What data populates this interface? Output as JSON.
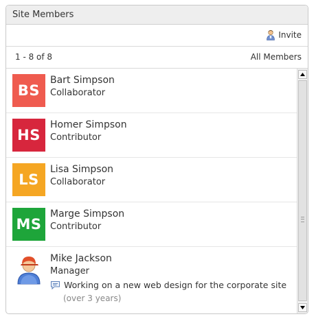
{
  "dashlet": {
    "title": "Site Members",
    "invite_label": "Invite",
    "count_text": "1 - 8 of 8",
    "all_members_label": "All Members"
  },
  "members": [
    {
      "initials": "BS",
      "name": "Bart Simpson",
      "role": "Collaborator",
      "color": "#ef5b4f"
    },
    {
      "initials": "HS",
      "name": "Homer Simpson",
      "role": "Contributor",
      "color": "#d7263d"
    },
    {
      "initials": "LS",
      "name": "Lisa Simpson",
      "role": "Collaborator",
      "color": "#f5a623"
    },
    {
      "initials": "MS",
      "name": "Marge Simpson",
      "role": "Contributor",
      "color": "#1ea53a"
    }
  ],
  "last_member": {
    "name": "Mike Jackson",
    "role": "Manager",
    "status": "Working on a new web design for the corporate site",
    "status_age": "(over 3 years)",
    "avatar_icon": "user-avatar-icon"
  }
}
